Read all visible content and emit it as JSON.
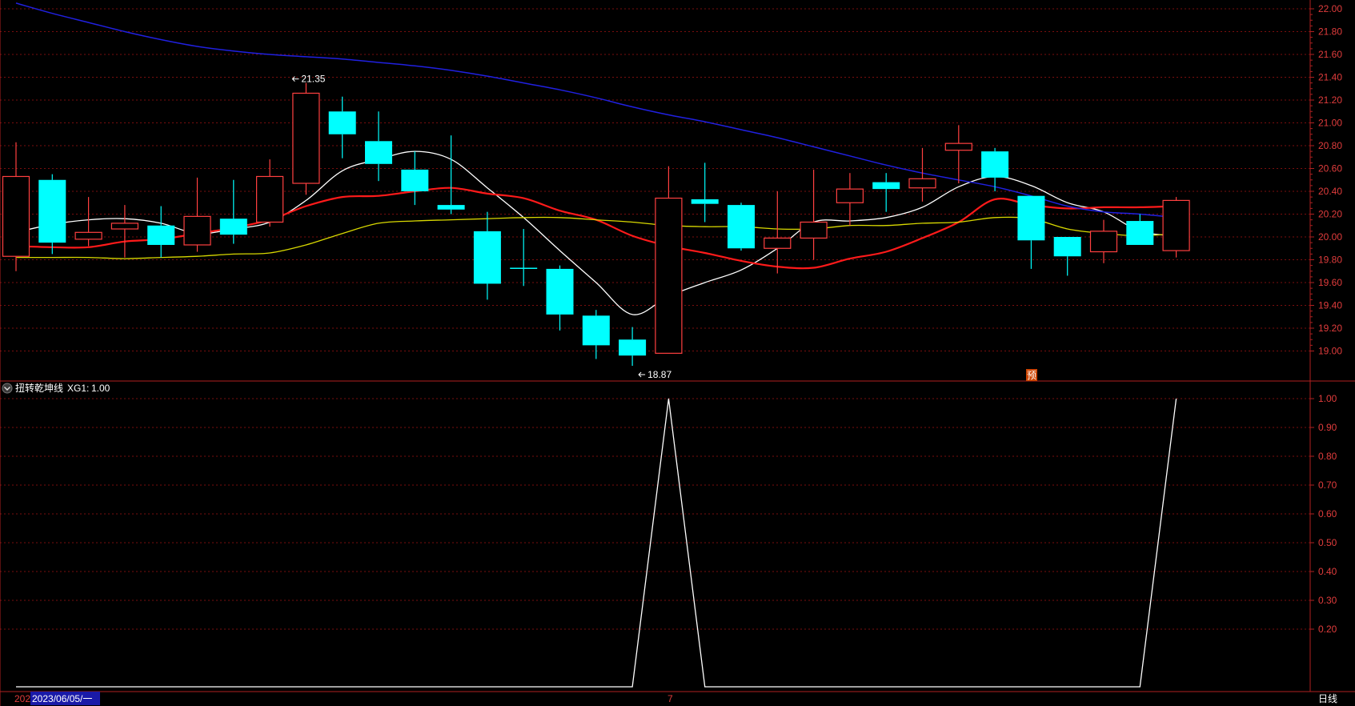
{
  "indicator_panel": {
    "name": "扭转乾坤线",
    "series_label": "XG1:",
    "current_value": "1.00"
  },
  "date_label": "2023/06/05/一",
  "bottom_left_label": "202",
  "bottom_mid_label": "7",
  "period_button": "日线",
  "forecast_badge": "预",
  "colors": {
    "background": "#000000",
    "grid": "#7a0e0e",
    "axis": "#b02020",
    "tick_text": "#e03c3c",
    "up_candle": "#ff4040",
    "down_candle": "#00ffff",
    "ma5": "#ffffff",
    "ma10": "#ff1a1a",
    "ma20": "#d8d800",
    "ma60": "#2020e0",
    "indicator_line": "#ffffff",
    "badge_bg": "#cc4400"
  },
  "chart_data": [
    {
      "type": "candlestick",
      "y_ticks": [
        "22.00",
        "21.80",
        "21.60",
        "21.40",
        "21.20",
        "21.00",
        "20.80",
        "20.60",
        "20.40",
        "20.20",
        "20.00",
        "19.80",
        "19.60",
        "19.40",
        "19.20",
        "19.00"
      ],
      "ylim": [
        18.74,
        22.05
      ],
      "grid": true,
      "annotations": [
        {
          "text": "21.35",
          "index": 8,
          "value": 21.35
        },
        {
          "text": "18.87",
          "index": 17,
          "value": 18.87
        }
      ],
      "candles": [
        {
          "o": 19.83,
          "c": 20.53,
          "h": 20.83,
          "l": 19.7
        },
        {
          "o": 20.5,
          "c": 19.95,
          "h": 20.55,
          "l": 19.85
        },
        {
          "o": 19.98,
          "c": 20.04,
          "h": 20.35,
          "l": 19.92
        },
        {
          "o": 20.07,
          "c": 20.12,
          "h": 20.28,
          "l": 19.82
        },
        {
          "o": 20.1,
          "c": 19.93,
          "h": 20.27,
          "l": 19.82
        },
        {
          "o": 19.93,
          "c": 20.18,
          "h": 20.52,
          "l": 19.87
        },
        {
          "o": 20.16,
          "c": 20.02,
          "h": 20.5,
          "l": 19.94
        },
        {
          "o": 20.13,
          "c": 20.53,
          "h": 20.68,
          "l": 20.09
        },
        {
          "o": 20.47,
          "c": 21.26,
          "h": 21.35,
          "l": 20.37
        },
        {
          "o": 21.1,
          "c": 20.9,
          "h": 21.23,
          "l": 20.69
        },
        {
          "o": 20.84,
          "c": 20.64,
          "h": 21.1,
          "l": 20.49
        },
        {
          "o": 20.59,
          "c": 20.4,
          "h": 20.75,
          "l": 20.28
        },
        {
          "o": 20.28,
          "c": 20.24,
          "h": 20.89,
          "l": 20.2
        },
        {
          "o": 20.05,
          "c": 19.59,
          "h": 20.22,
          "l": 19.45
        },
        {
          "o": 19.73,
          "c": 19.72,
          "h": 20.07,
          "l": 19.57
        },
        {
          "o": 19.72,
          "c": 19.32,
          "h": 19.75,
          "l": 19.18
        },
        {
          "o": 19.31,
          "c": 19.05,
          "h": 19.36,
          "l": 18.93
        },
        {
          "o": 19.1,
          "c": 18.96,
          "h": 19.21,
          "l": 18.87
        },
        {
          "o": 18.98,
          "c": 20.34,
          "h": 20.62,
          "l": 18.98
        },
        {
          "o": 20.33,
          "c": 20.29,
          "h": 20.65,
          "l": 20.13
        },
        {
          "o": 20.28,
          "c": 19.9,
          "h": 20.3,
          "l": 19.88
        },
        {
          "o": 19.9,
          "c": 19.99,
          "h": 20.4,
          "l": 19.68
        },
        {
          "o": 19.99,
          "c": 20.13,
          "h": 20.59,
          "l": 19.8
        },
        {
          "o": 20.3,
          "c": 20.42,
          "h": 20.56,
          "l": 20.1
        },
        {
          "o": 20.48,
          "c": 20.42,
          "h": 20.56,
          "l": 20.22
        },
        {
          "o": 20.43,
          "c": 20.51,
          "h": 20.78,
          "l": 20.31
        },
        {
          "o": 20.76,
          "c": 20.82,
          "h": 20.98,
          "l": 20.47
        },
        {
          "o": 20.75,
          "c": 20.52,
          "h": 20.78,
          "l": 20.4
        },
        {
          "o": 20.36,
          "c": 19.97,
          "h": 20.36,
          "l": 19.72
        },
        {
          "o": 20.0,
          "c": 19.83,
          "h": 20.0,
          "l": 19.66
        },
        {
          "o": 19.87,
          "c": 20.05,
          "h": 20.15,
          "l": 19.77
        },
        {
          "o": 20.14,
          "c": 19.93,
          "h": 20.2,
          "l": 19.93
        },
        {
          "o": 19.88,
          "c": 20.32,
          "h": 20.35,
          "l": 19.82
        }
      ],
      "series": [
        {
          "name": "",
          "color": "#ffffff",
          "values": [
            20.04,
            20.11,
            20.15,
            20.16,
            20.12,
            20.03,
            20.07,
            20.13,
            20.32,
            20.58,
            20.68,
            20.75,
            20.68,
            20.43,
            20.17,
            19.88,
            19.6,
            19.32,
            19.48,
            19.6,
            19.71,
            19.9,
            20.13,
            20.14,
            20.17,
            20.26,
            20.44,
            20.53,
            20.45,
            20.3,
            20.22,
            20.05,
            20.01
          ]
        },
        {
          "name": "",
          "color": "#ff1a1a",
          "values": [
            19.92,
            19.91,
            19.91,
            19.96,
            19.98,
            20.03,
            20.08,
            20.15,
            20.27,
            20.35,
            20.36,
            20.4,
            20.43,
            20.38,
            20.34,
            20.23,
            20.15,
            20.01,
            19.92,
            19.86,
            19.79,
            19.74,
            19.73,
            19.81,
            19.87,
            19.99,
            20.13,
            20.33,
            20.28,
            20.25,
            20.26,
            20.26,
            20.27
          ]
        },
        {
          "name": "",
          "color": "#d8d800",
          "values": [
            19.82,
            19.82,
            19.82,
            19.81,
            19.82,
            19.83,
            19.85,
            19.86,
            19.93,
            20.03,
            20.12,
            20.14,
            20.15,
            20.16,
            20.17,
            20.17,
            20.15,
            20.13,
            20.1,
            20.09,
            20.09,
            20.07,
            20.07,
            20.1,
            20.1,
            20.12,
            20.13,
            20.17,
            20.16,
            20.07,
            20.03,
            20.01,
            20.03
          ]
        },
        {
          "name": "",
          "color": "#2020e0",
          "values": [
            22.05,
            21.96,
            21.88,
            21.8,
            21.73,
            21.67,
            21.63,
            21.6,
            21.58,
            21.56,
            21.53,
            21.5,
            21.46,
            21.41,
            21.35,
            21.29,
            21.22,
            21.14,
            21.07,
            21.01,
            20.94,
            20.87,
            20.79,
            20.71,
            20.63,
            20.56,
            20.5,
            20.44,
            20.36,
            20.27,
            20.22,
            20.2,
            20.17
          ]
        }
      ]
    },
    {
      "type": "line",
      "y_ticks": [
        "1.00",
        "0.90",
        "0.80",
        "0.70",
        "0.60",
        "0.50",
        "0.40",
        "0.30",
        "0.20"
      ],
      "ylim": [
        0,
        1
      ],
      "series": [
        {
          "name": "XG1",
          "color": "#ffffff",
          "points": [
            [
              0,
              0
            ],
            [
              17,
              0
            ],
            [
              18,
              1
            ],
            [
              19,
              0
            ],
            [
              31,
              0
            ],
            [
              32,
              1
            ]
          ]
        }
      ]
    }
  ]
}
